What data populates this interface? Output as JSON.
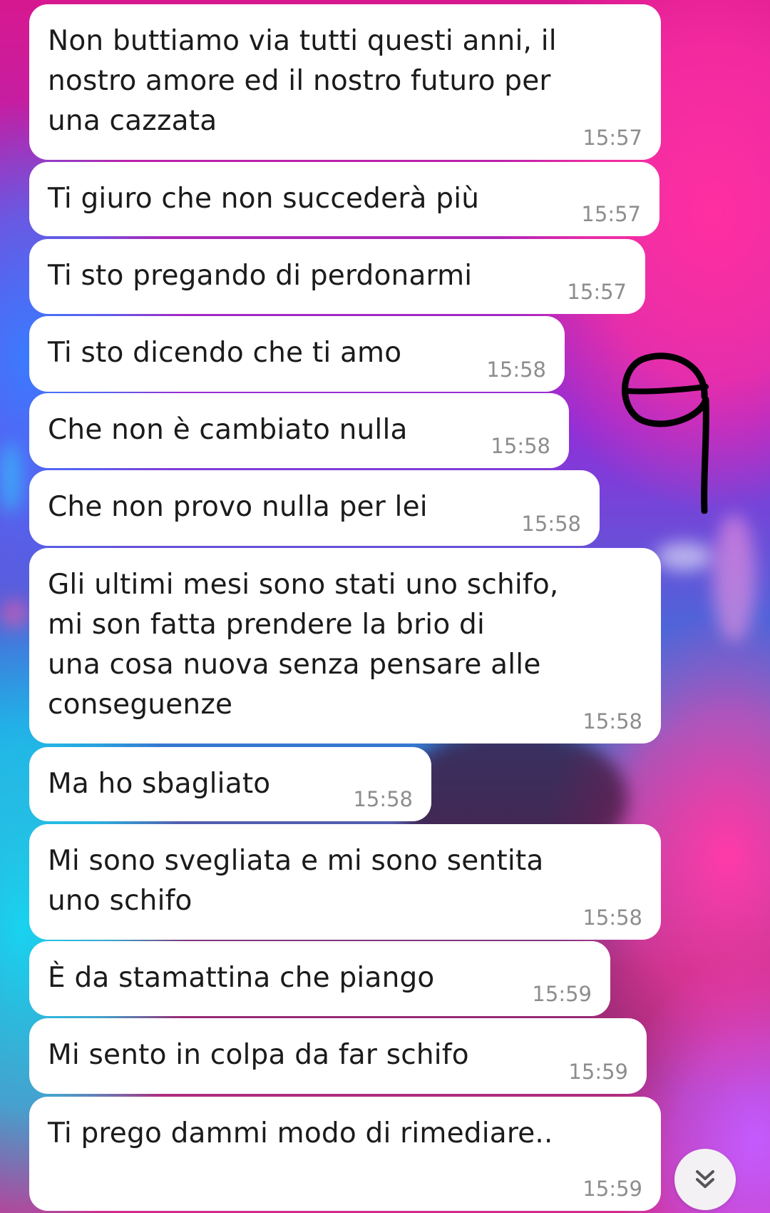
{
  "messages": [
    {
      "text": "Non buttiamo via tutti questi anni, il\nnostro amore ed il nostro futuro per\nuna cazzata",
      "time": "15:57"
    },
    {
      "text": "Ti giuro che non succederà più",
      "time": "15:57"
    },
    {
      "text": "Ti sto pregando di perdonarmi",
      "time": "15:57"
    },
    {
      "text": "Ti sto dicendo che ti amo",
      "time": "15:58"
    },
    {
      "text": "Che non è cambiato nulla",
      "time": "15:58"
    },
    {
      "text": "Che non provo nulla per lei",
      "time": "15:58"
    },
    {
      "text": "Gli ultimi mesi sono stati uno schifo,\nmi son fatta prendere la brio di\nuna cosa nuova senza pensare alle\nconseguenze",
      "time": "15:58"
    },
    {
      "text": "Ma ho sbagliato",
      "time": "15:58"
    },
    {
      "text": "Mi sono svegliata e mi sono sentita\nuno schifo",
      "time": "15:58"
    },
    {
      "text": "È da stamattina che piango",
      "time": "15:59"
    },
    {
      "text": "Mi sento in colpa da far schifo",
      "time": "15:59"
    },
    {
      "text": "Ti prego dammi modo di rimediare..",
      "time": "15:59"
    }
  ],
  "scroll_button": {
    "icon": "double-chevron-down-icon"
  },
  "annotation": {
    "icon": "handwritten-scribble"
  },
  "colors": {
    "bubble": "#ffffff",
    "text": "#1b1b1b",
    "time": "#8d8d8d",
    "scroll_button_bg": "#f3f1f4"
  }
}
